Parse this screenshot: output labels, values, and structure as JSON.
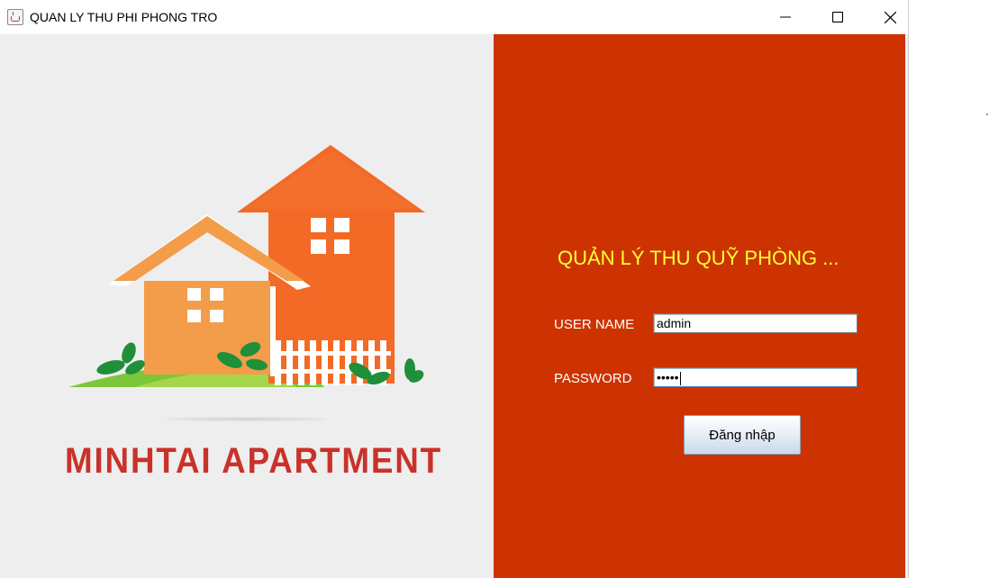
{
  "window": {
    "title": "QUAN LY THU PHI PHONG TRO",
    "icon": "java-cup-icon",
    "controls": [
      "minimize-icon",
      "maximize-icon",
      "close-icon"
    ]
  },
  "brand": {
    "logo": "house-logo-icon",
    "name": "MINHTAI APARTMENT"
  },
  "login": {
    "heading": "QUẢN LÝ THU QUỸ PHÒNG ...",
    "username_label": "USER NAME",
    "username_value": "admin",
    "password_label": "PASSWORD",
    "password_mask": "•••••",
    "submit_label": "Đăng nhập"
  },
  "colors": {
    "panel": "#cc3300",
    "heading": "#ffff33",
    "brand_text": "#c9322a"
  }
}
